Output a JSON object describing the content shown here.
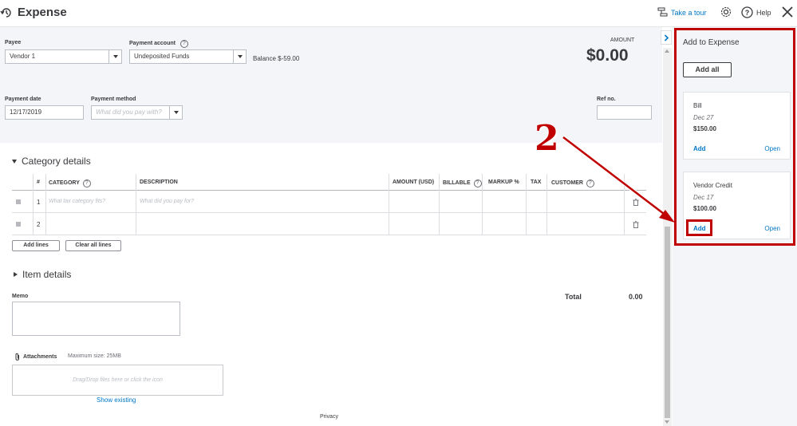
{
  "header": {
    "title": "Expense",
    "take_tour": "Take a tour",
    "help": "Help"
  },
  "form": {
    "payee_label": "Payee",
    "payee_value": "Vendor 1",
    "payment_account_label": "Payment account",
    "payment_account_value": "Undeposited Funds",
    "balance_text": "Balance $-59.00",
    "amount_label": "AMOUNT",
    "amount_value": "$0.00",
    "payment_date_label": "Payment date",
    "payment_date_value": "12/17/2019",
    "payment_method_label": "Payment method",
    "payment_method_placeholder": "What did you pay with?",
    "ref_no_label": "Ref no.",
    "ref_no_value": ""
  },
  "category_details": {
    "title": "Category details",
    "columns": [
      "#",
      "CATEGORY",
      "DESCRIPTION",
      "AMOUNT (USD)",
      "BILLABLE",
      "MARKUP %",
      "TAX",
      "CUSTOMER"
    ],
    "rows": [
      {
        "num": "1",
        "category_placeholder": "What tax category fits?",
        "description_placeholder": "What did you pay for?"
      },
      {
        "num": "2",
        "category_placeholder": "",
        "description_placeholder": ""
      }
    ],
    "add_lines": "Add lines",
    "clear_all_lines": "Clear all lines"
  },
  "item_details": {
    "title": "Item details"
  },
  "memo": {
    "label": "Memo"
  },
  "total": {
    "label": "Total",
    "value": "0.00"
  },
  "attachments": {
    "label": "Attachments",
    "max_size": "Maximum size: 25MB",
    "dropzone": "Drag/Drop files here or click the icon",
    "show_existing": "Show existing"
  },
  "footer": {
    "privacy": "Privacy"
  },
  "side_panel": {
    "title": "Add to Expense",
    "add_all": "Add all",
    "cards": [
      {
        "name": "Bill",
        "date": "Dec 27",
        "amount": "$150.00",
        "add": "Add",
        "open": "Open"
      },
      {
        "name": "Vendor Credit",
        "date": "Dec 17",
        "amount": "$100.00",
        "add": "Add",
        "open": "Open"
      }
    ]
  },
  "annotation": {
    "step": "2",
    "color": "#c00000"
  },
  "colors": {
    "link": "#0077c5",
    "text": "#393a3d",
    "header_bg": "#f4f5f8"
  }
}
